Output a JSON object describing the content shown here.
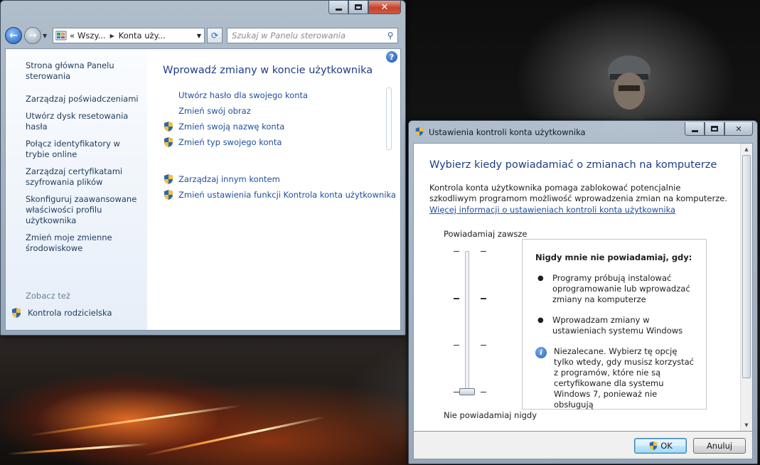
{
  "control_panel": {
    "address": {
      "prefix": "«",
      "crumb1": "Wszy...",
      "crumb2": "Konta uży..."
    },
    "search": {
      "placeholder": "Szukaj w Panelu sterowania"
    },
    "sidebar": {
      "items": [
        {
          "label": "Strona główna Panelu sterowania"
        },
        {
          "label": "Zarządzaj poświadczeniami"
        },
        {
          "label": "Utwórz dysk resetowania hasła"
        },
        {
          "label": "Połącz identyfikatory w trybie online"
        },
        {
          "label": "Zarządzaj certyfikatami szyfrowania plików"
        },
        {
          "label": "Skonfiguruj zaawansowane właściwości profilu użytkownika"
        },
        {
          "label": "Zmień moje zmienne środowiskowe"
        }
      ],
      "see_also": "Zobacz też",
      "parental": "Kontrola rodzicielska"
    },
    "main": {
      "title": "Wprowadź zmiany w koncie użytkownika",
      "tasks": [
        {
          "label": "Utwórz hasło dla swojego konta",
          "shield": false
        },
        {
          "label": "Zmień swój obraz",
          "shield": false
        },
        {
          "label": "Zmień swoją nazwę konta",
          "shield": true
        },
        {
          "label": "Zmień typ swojego konta",
          "shield": true
        }
      ],
      "tasks2": [
        {
          "label": "Zarządzaj innym kontem",
          "shield": true
        },
        {
          "label": "Zmień ustawienia funkcji Kontrola konta użytkownika",
          "shield": true
        }
      ]
    }
  },
  "uac": {
    "title": "Ustawienia kontroli konta użytkownika",
    "heading": "Wybierz kiedy powiadamiać o zmianach na komputerze",
    "description": "Kontrola konta użytkownika pomaga zablokować potencjalnie szkodliwym programom możliwość wprowadzenia zmian na komputerze.",
    "link": "Więcej informacji o ustawieniach kontroli konta użytkownika",
    "slider": {
      "top_label": "Powiadamiaj zawsze",
      "bottom_label": "Nie powiadamiaj nigdy",
      "level": 0,
      "levels": 4
    },
    "info": {
      "heading": "Nigdy mnie nie powiadamiaj, gdy:",
      "bullets": [
        "Programy próbują instalować oprogramowanie lub wprowadzać zmiany na komputerze",
        "Wprowadzam zmiany w ustawieniach systemu Windows"
      ],
      "note": "Niezalecane. Wybierz tę opcję tylko wtedy, gdy musisz korzystać z programów, które nie są certyfikowane dla systemu Windows 7, ponieważ nie obsługują"
    },
    "buttons": {
      "ok": "OK",
      "cancel": "Anuluj"
    }
  },
  "colors": {
    "link": "#1f4e9e",
    "heading": "#1f3c87",
    "close": "#c4412c"
  }
}
